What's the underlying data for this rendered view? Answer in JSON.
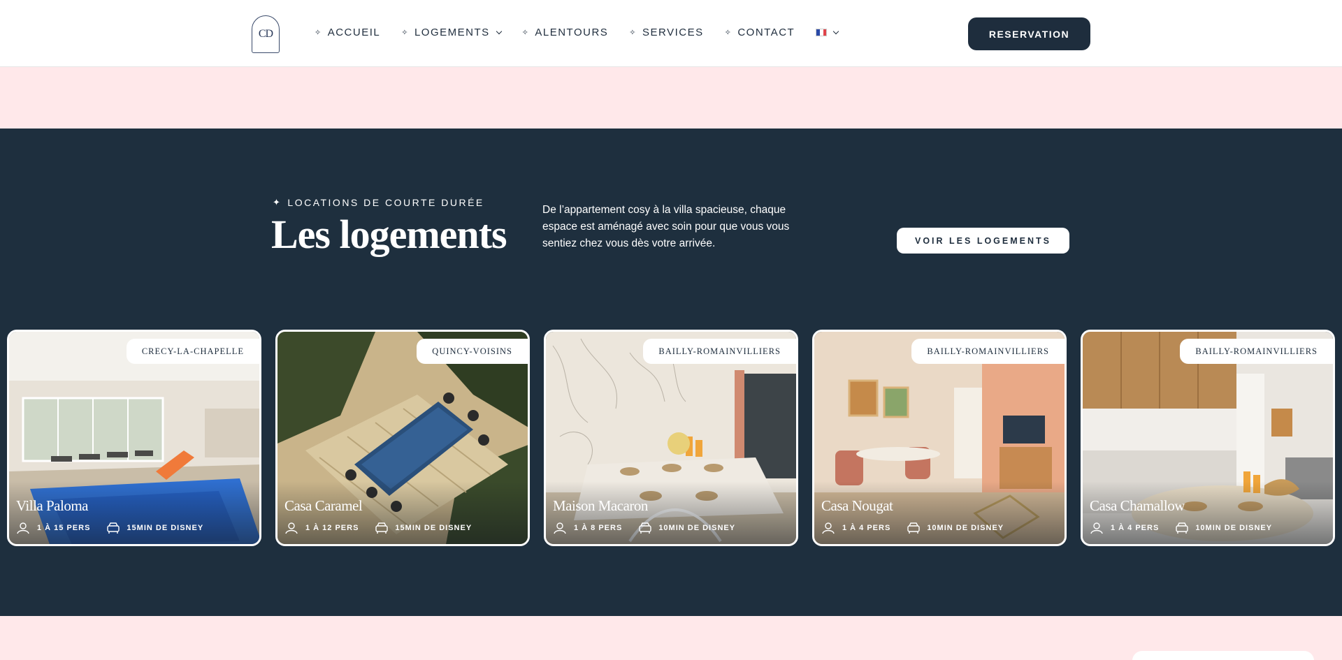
{
  "header": {
    "logo_text": "CD",
    "nav": [
      {
        "label": "ACCUEIL",
        "dropdown": false
      },
      {
        "label": "LOGEMENTS",
        "dropdown": true
      },
      {
        "label": "ALENTOURS",
        "dropdown": false
      },
      {
        "label": "SERVICES",
        "dropdown": false
      },
      {
        "label": "CONTACT",
        "dropdown": false
      }
    ],
    "language": "fr",
    "reserve_label": "RESERVATION"
  },
  "section": {
    "eyebrow": "LOCATIONS DE COURTE DURÉE",
    "title": "Les logements",
    "description": "De l’appartement cosy à la villa spacieuse, chaque espace est aménagé avec soin pour que vous vous sentiez chez vous dès votre arrivée.",
    "button_label": "VOIR LES LOGEMENTS"
  },
  "cards": [
    {
      "name": "Villa Paloma",
      "location": "CRECY-LA-CHAPELLE",
      "capacity": "1 À 15 PERS",
      "distance": "15MIN DE DISNEY"
    },
    {
      "name": "Casa Caramel",
      "location": "QUINCY-VOISINS",
      "capacity": "1 À 12 PERS",
      "distance": "15MIN DE DISNEY"
    },
    {
      "name": "Maison Macaron",
      "location": "BAILLY-ROMAINVILLIERS",
      "capacity": "1 À 8 PERS",
      "distance": "10MIN DE DISNEY"
    },
    {
      "name": "Casa Nougat",
      "location": "BAILLY-ROMAINVILLIERS",
      "capacity": "1 À 4 PERS",
      "distance": "10MIN DE DISNEY"
    },
    {
      "name": "Casa Chamallow",
      "location": "BAILLY-ROMAINVILLIERS",
      "capacity": "1 À 4 PERS",
      "distance": "10MIN DE DISNEY"
    }
  ],
  "colors": {
    "navy": "#1e2f3e",
    "pink": "#ffe8ea",
    "white": "#ffffff"
  }
}
